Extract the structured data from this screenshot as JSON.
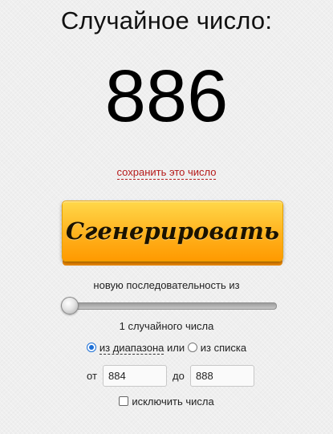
{
  "title": "Случайное число:",
  "result": "886",
  "save_link": "сохранить это число",
  "generate_button": "Сгенерировать",
  "sequence_label": "новую последовательность из",
  "slider": {
    "value": 1
  },
  "count_label": "1 случайного числа",
  "mode": {
    "range_option": "из диапазона",
    "or": "или",
    "list_option": "из списка",
    "selected": "range"
  },
  "range": {
    "from_label": "от",
    "from_value": "884",
    "to_label": "до",
    "to_value": "888"
  },
  "exclude_label": "исключить числа",
  "colors": {
    "link": "#b51a1a",
    "button": "#ffb21e",
    "radio_selected": "#1c6fd6"
  }
}
